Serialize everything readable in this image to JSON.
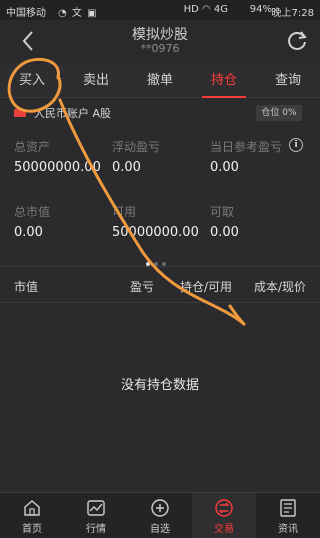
{
  "status_bar": {
    "carrier": "中国移动",
    "left_icons": "◔ 文 ▣",
    "right_icons": "HD ◠ 4G",
    "battery": "94%",
    "time": "晚上7:28"
  },
  "header": {
    "title": "模拟炒股",
    "subtitle": "**0976"
  },
  "tabs": [
    {
      "label": "买入"
    },
    {
      "label": "卖出"
    },
    {
      "label": "撤单"
    },
    {
      "label": "持仓"
    },
    {
      "label": "查询"
    }
  ],
  "active_tab": "持仓",
  "account": {
    "label": "人民币账户 A股",
    "position_ratio": "仓位 0%"
  },
  "stats": {
    "total_assets": {
      "label": "总资产",
      "value": "50000000.00"
    },
    "floating_pnl": {
      "label": "浮动盈亏",
      "value": "0.00"
    },
    "daily_pnl": {
      "label": "当日参考盈亏",
      "value": "0.00"
    },
    "market_value": {
      "label": "总市值",
      "value": "0.00"
    },
    "available": {
      "label": "可用",
      "value": "50000000.00"
    },
    "withdrawable": {
      "label": "可取",
      "value": "0.00"
    }
  },
  "table": {
    "headers": [
      "市值",
      "盈亏",
      "持仓/可用",
      "成本/现价"
    ],
    "empty_text": "没有持仓数据"
  },
  "bottom_nav": [
    {
      "label": "首页",
      "icon": "home-icon"
    },
    {
      "label": "行情",
      "icon": "chart-icon"
    },
    {
      "label": "自选",
      "icon": "watchlist-icon"
    },
    {
      "label": "交易",
      "icon": "trade-icon"
    },
    {
      "label": "资讯",
      "icon": "news-icon"
    }
  ],
  "colors": {
    "accent": "#ff3b3b",
    "annotation": "#f09a3e",
    "background": "#2b2b2d"
  }
}
